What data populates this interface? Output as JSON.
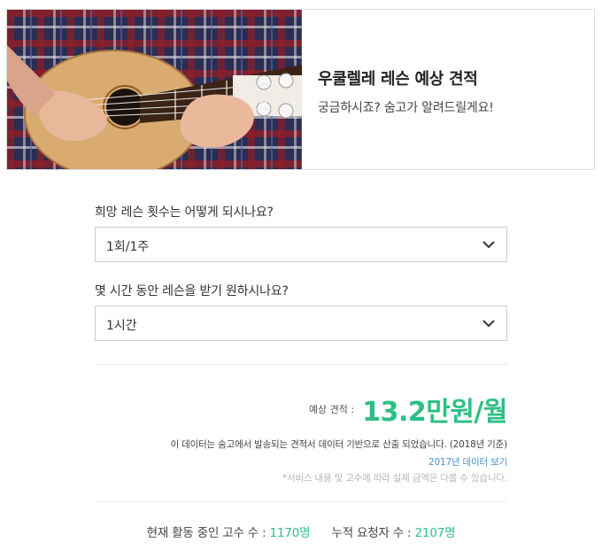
{
  "hero": {
    "title": "우쿨렐레 레슨 예상 견적",
    "subtitle": "궁금하시죠? 숨고가 알려드릴게요!"
  },
  "questions": [
    {
      "label": "희망 레슨 횟수는 어떻게 되시나요?",
      "selected": "1회/1주"
    },
    {
      "label": "몇 시간 동안 레슨을 받기 원하시나요?",
      "selected": "1시간"
    }
  ],
  "estimate": {
    "label": "예상 견적",
    "value": "13.2만원/월"
  },
  "notes": {
    "source": "이 데이터는 숨고에서 발송되는 견적서 데이터 기반으로 산출 되었습니다. (2018년 기준)",
    "link": "2017년 데이터 보기",
    "disclaimer": "*서비스 내용 및 고수에 따라 실제 금액은 다를 수 있습니다."
  },
  "stats": {
    "active_label": "현재 활동 중인 고수 수 :",
    "active_value": "1170명",
    "requests_label": "누적 요청자 수 :",
    "requests_value": "2107명"
  },
  "colors": {
    "accent": "#2dbf85",
    "link": "#4a90c8"
  },
  "icons": {
    "dropdown": "chevron-down-icon"
  }
}
